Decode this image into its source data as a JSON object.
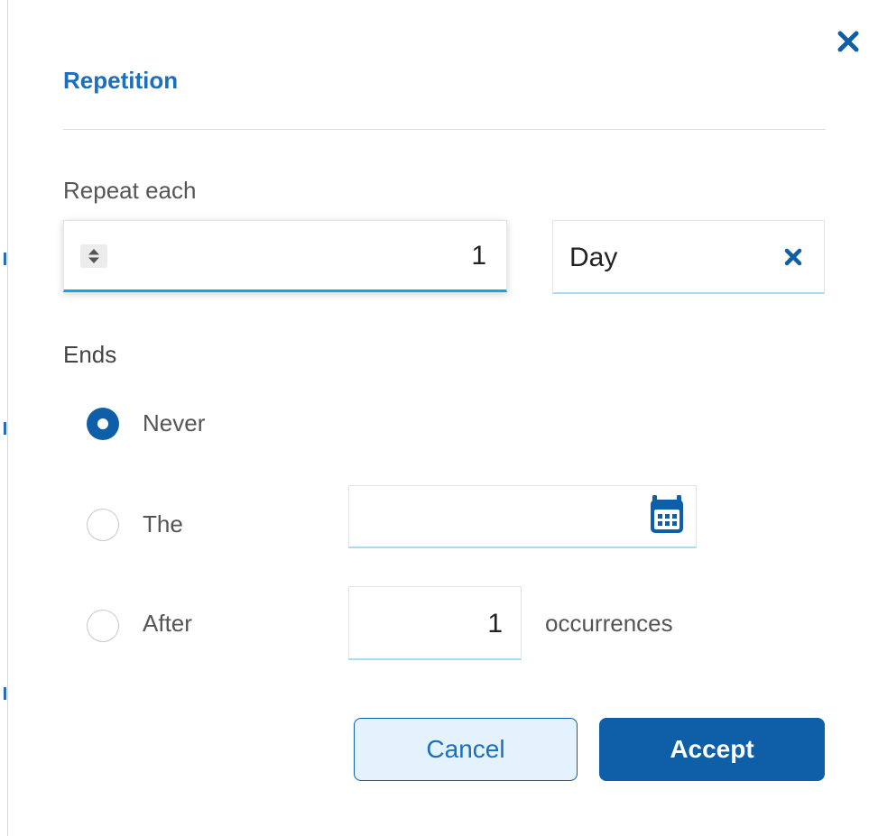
{
  "dialog": {
    "title": "Repetition",
    "close_icon": "close-icon"
  },
  "repeat": {
    "label": "Repeat each",
    "interval_value": "1",
    "stepper_icon": "sort-arrows-icon",
    "unit_value": "Day",
    "unit_clear_icon": "close-icon"
  },
  "ends": {
    "label": "Ends",
    "selected": "never",
    "options": [
      {
        "id": "never",
        "label": "Never"
      },
      {
        "id": "on_date",
        "label": "The"
      },
      {
        "id": "after",
        "label": "After"
      }
    ],
    "date_value": "",
    "calendar_icon": "calendar-icon",
    "occurrences_value": "1",
    "occurrences_label": "occurrences"
  },
  "actions": {
    "cancel_label": "Cancel",
    "accept_label": "Accept"
  },
  "colors": {
    "primary": "#0f5ea8",
    "title": "#1a6fbe",
    "focus_underline": "#11a4e8",
    "idle_underline": "#a8dcf4",
    "cancel_bg": "#e3f2fc"
  }
}
